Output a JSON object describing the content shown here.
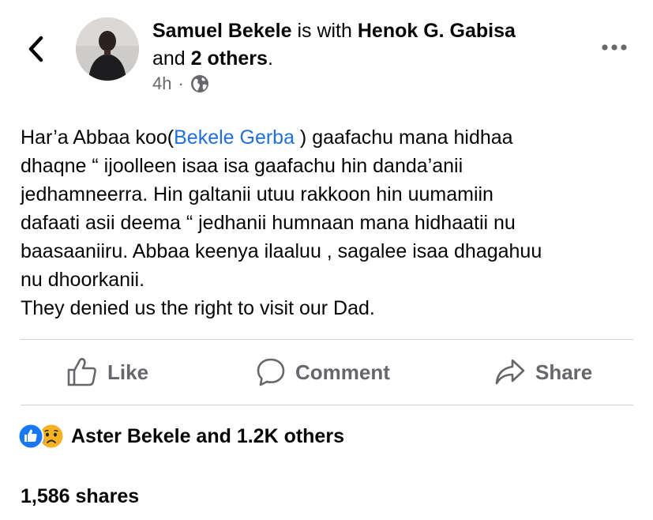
{
  "header": {
    "author": "Samuel Bekele",
    "is_with": "is with",
    "tagged": "Henok G. Gabisa",
    "and_word": "and",
    "others": "2 others",
    "period": ".",
    "time": "4h",
    "dot": "·"
  },
  "post": {
    "line1_pre": "Har’a Abbaa koo(",
    "line1_link": "Bekele Gerba",
    "line1_post": " ) gaafachu mana hidhaa",
    "line2": "dhaqne “ ijoolleen isaa isa gaafachu hin danda’anii",
    "line3": "jedhamneerra. Hin galtanii utuu rakkoon hin uumamiin",
    "line4": "dafaati asii deema “ jedhanii humnaan mana hidhaatii nu",
    "line5": "baasaaniiru. Abbaa keenya ilaaluu , sagalee isaa dhagahuu",
    "line6": "nu dhoorkanii.",
    "line7": "They denied us the right to visit our Dad."
  },
  "actions": {
    "like": "Like",
    "comment": "Comment",
    "share": "Share"
  },
  "reactions": {
    "summary": "Aster Bekele and 1.2K others"
  },
  "shares": {
    "count": "1,586 shares"
  },
  "colors": {
    "link": "#216fdb",
    "secondary_text": "#65676b",
    "like_blue": "#1877f2",
    "sad_yellow": "#f7b125"
  },
  "icons": [
    "back-arrow-icon",
    "more-options-icon",
    "globe-icon",
    "like-icon",
    "comment-icon",
    "share-icon",
    "like-reaction-icon",
    "sad-reaction-icon"
  ]
}
